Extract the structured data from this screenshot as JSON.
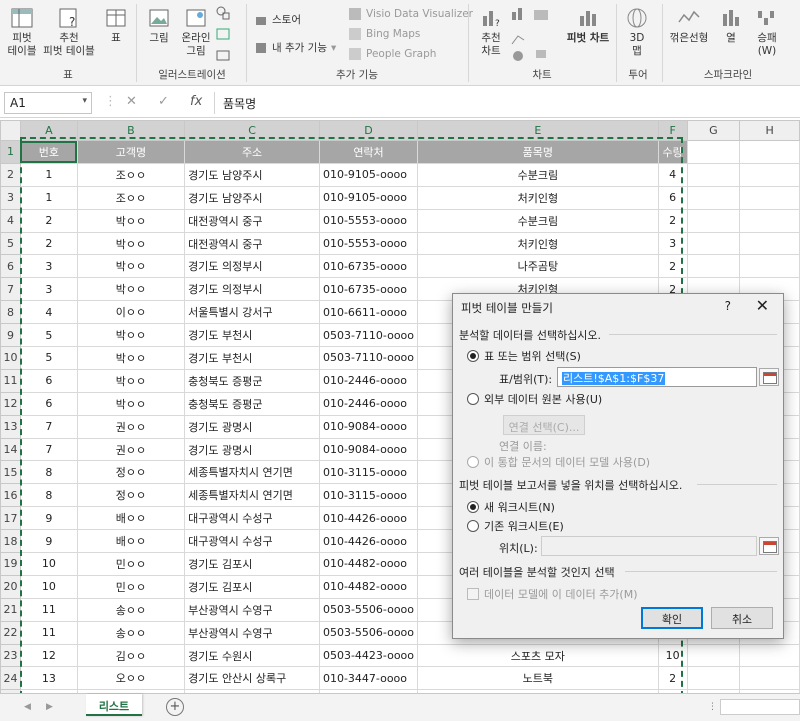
{
  "ribbon": {
    "pivot_table": "피벗\n테이블",
    "recommended_pivot": "추천\n피벗 테이블",
    "table": "표",
    "group_tables": "표",
    "picture": "그림",
    "online_picture": "온라인\n그림",
    "group_illustrations": "일러스트레이션",
    "store": "스토어",
    "my_addins": "내 추가 기능",
    "visio": "Visio Data Visualizer",
    "bing_maps": "Bing Maps",
    "people_graph": "People Graph",
    "group_addins": "추가 기능",
    "recommended_charts": "추천\n차트",
    "pivot_chart": "피벗 차트",
    "group_charts": "차트",
    "map_3d": "3D\n맵",
    "group_tours": "투어",
    "sparkline_line": "꺾은선형",
    "sparkline_column": "열",
    "sparkline_winloss": "승패\n(W)",
    "group_sparklines": "스파크라인"
  },
  "formula_bar": {
    "name_box": "A1",
    "cancel_icon": "✕",
    "enter_icon": "✓",
    "fx": "fx",
    "content": "품목명"
  },
  "sheet": {
    "columns": [
      "A",
      "B",
      "C",
      "D",
      "E",
      "F",
      "G",
      "H"
    ],
    "headers": [
      "번호",
      "고객명",
      "주소",
      "연락처",
      "품목명",
      "수량"
    ],
    "rows": [
      [
        "1",
        "조ㅇㅇ",
        "경기도 남양주시",
        "010-9105-oooo",
        "수분크림",
        "4"
      ],
      [
        "1",
        "조ㅇㅇ",
        "경기도 남양주시",
        "010-9105-oooo",
        "처키인형",
        "6"
      ],
      [
        "2",
        "박ㅇㅇ",
        "대전광역시 중구",
        "010-5553-oooo",
        "수분크림",
        "2"
      ],
      [
        "2",
        "박ㅇㅇ",
        "대전광역시 중구",
        "010-5553-oooo",
        "처키인형",
        "3"
      ],
      [
        "3",
        "박ㅇㅇ",
        "경기도 의정부시",
        "010-6735-oooo",
        "나주곰탕",
        "2"
      ],
      [
        "3",
        "박ㅇㅇ",
        "경기도 의정부시",
        "010-6735-oooo",
        "처키인형",
        "2"
      ],
      [
        "4",
        "이ㅇㅇ",
        "서울특별시 강서구",
        "010-6611-oooo",
        "",
        ""
      ],
      [
        "5",
        "박ㅇㅇ",
        "경기도 부천시",
        "0503-7110-oooo",
        "",
        ""
      ],
      [
        "5",
        "박ㅇㅇ",
        "경기도 부천시",
        "0503-7110-oooo",
        "",
        ""
      ],
      [
        "6",
        "박ㅇㅇ",
        "충청북도 증평군",
        "010-2446-oooo",
        "",
        ""
      ],
      [
        "6",
        "박ㅇㅇ",
        "충청북도 증평군",
        "010-2446-oooo",
        "",
        ""
      ],
      [
        "7",
        "권ㅇㅇ",
        "경기도 광명시",
        "010-9084-oooo",
        "",
        ""
      ],
      [
        "7",
        "권ㅇㅇ",
        "경기도 광명시",
        "010-9084-oooo",
        "",
        ""
      ],
      [
        "8",
        "정ㅇㅇ",
        "세종특별자치시 연기면",
        "010-3115-oooo",
        "",
        ""
      ],
      [
        "8",
        "정ㅇㅇ",
        "세종특별자치시 연기면",
        "010-3115-oooo",
        "",
        ""
      ],
      [
        "9",
        "배ㅇㅇ",
        "대구광역시 수성구",
        "010-4426-oooo",
        "",
        ""
      ],
      [
        "9",
        "배ㅇㅇ",
        "대구광역시 수성구",
        "010-4426-oooo",
        "",
        ""
      ],
      [
        "10",
        "민ㅇㅇ",
        "경기도 김포시",
        "010-4482-oooo",
        "",
        ""
      ],
      [
        "10",
        "민ㅇㅇ",
        "경기도 김포시",
        "010-4482-oooo",
        "",
        ""
      ],
      [
        "11",
        "송ㅇㅇ",
        "부산광역시 수영구",
        "0503-5506-oooo",
        "",
        ""
      ],
      [
        "11",
        "송ㅇㅇ",
        "부산광역시 수영구",
        "0503-5506-oooo",
        "",
        ""
      ],
      [
        "12",
        "김ㅇㅇ",
        "경기도 수원시",
        "0503-4423-oooo",
        "스포츠 모자",
        "10"
      ],
      [
        "13",
        "오ㅇㅇ",
        "경기도 안산시 상록구",
        "010-3447-oooo",
        "노트북",
        "2"
      ],
      [
        "13",
        "오ㅇㅇ",
        "경기도 안산시 상록구",
        "010-3447-oooo",
        "스포츠 모자",
        "3"
      ]
    ]
  },
  "tabs": {
    "active": "리스트",
    "add": "+"
  },
  "dialog": {
    "title": "피벗 테이블 만들기",
    "help": "?",
    "close": "✕",
    "section1": "분석할 데이터를 선택하십시오.",
    "opt_table": "표 또는 범위 선택(S)",
    "range_label": "표/범위(T):",
    "range_value": "리스트!$A$1:$F$37",
    "opt_external": "외부 데이터 원본 사용(U)",
    "choose_connection": "연결 선택(C)...",
    "connection_name": "연결 이름:",
    "opt_model": "이 통합 문서의 데이터 모델 사용(D)",
    "section2": "피벗 테이블 보고서를 넣을 위치를 선택하십시오.",
    "opt_new": "새 워크시트(N)",
    "opt_existing": "기존 워크시트(E)",
    "location_label": "위치(L):",
    "section3": "여러 테이블을 분석할 것인지 선택",
    "add_model": "데이터 모델에 이 데이터 추가(M)",
    "ok": "확인",
    "cancel": "취소"
  },
  "colors": {
    "excel_green": "#217346",
    "header_fill": "#a6a6a6",
    "dialog_bg": "#f0f0f0",
    "primary_border": "#0078d7"
  }
}
